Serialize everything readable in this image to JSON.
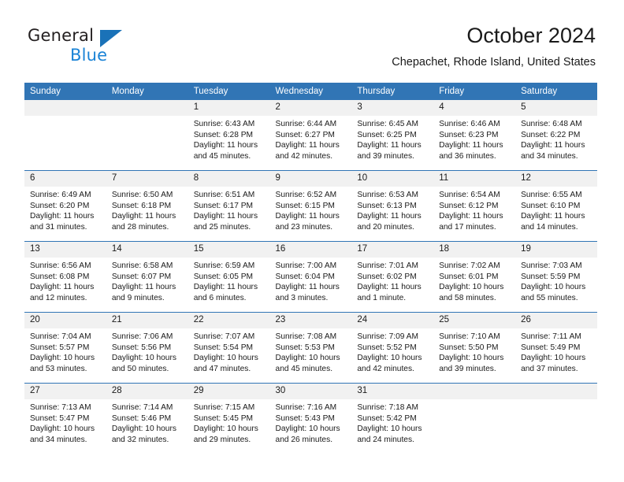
{
  "brand": {
    "name_part1": "General",
    "name_part2": "Blue",
    "logo_icon": "blue-triangle-icon"
  },
  "header": {
    "title": "October 2024",
    "location": "Chepachet, Rhode Island, United States"
  },
  "colors": {
    "header_blue": "#3175b5",
    "daynum_band": "#f1f1f1",
    "brand_blue": "#1a83d6",
    "logo_blue": "#1a72b8",
    "text": "#1a1a1a"
  },
  "calendar": {
    "weekday_headers": [
      "Sunday",
      "Monday",
      "Tuesday",
      "Wednesday",
      "Thursday",
      "Friday",
      "Saturday"
    ],
    "labels": {
      "sunrise": "Sunrise:",
      "sunset": "Sunset:",
      "daylight": "Daylight:"
    },
    "weeks": [
      [
        {
          "day": "",
          "empty": true
        },
        {
          "day": "",
          "empty": true
        },
        {
          "day": "1",
          "sunrise": "Sunrise: 6:43 AM",
          "sunset": "Sunset: 6:28 PM",
          "daylight_line1": "Daylight: 11 hours",
          "daylight_line2": "and 45 minutes."
        },
        {
          "day": "2",
          "sunrise": "Sunrise: 6:44 AM",
          "sunset": "Sunset: 6:27 PM",
          "daylight_line1": "Daylight: 11 hours",
          "daylight_line2": "and 42 minutes."
        },
        {
          "day": "3",
          "sunrise": "Sunrise: 6:45 AM",
          "sunset": "Sunset: 6:25 PM",
          "daylight_line1": "Daylight: 11 hours",
          "daylight_line2": "and 39 minutes."
        },
        {
          "day": "4",
          "sunrise": "Sunrise: 6:46 AM",
          "sunset": "Sunset: 6:23 PM",
          "daylight_line1": "Daylight: 11 hours",
          "daylight_line2": "and 36 minutes."
        },
        {
          "day": "5",
          "sunrise": "Sunrise: 6:48 AM",
          "sunset": "Sunset: 6:22 PM",
          "daylight_line1": "Daylight: 11 hours",
          "daylight_line2": "and 34 minutes."
        }
      ],
      [
        {
          "day": "6",
          "sunrise": "Sunrise: 6:49 AM",
          "sunset": "Sunset: 6:20 PM",
          "daylight_line1": "Daylight: 11 hours",
          "daylight_line2": "and 31 minutes."
        },
        {
          "day": "7",
          "sunrise": "Sunrise: 6:50 AM",
          "sunset": "Sunset: 6:18 PM",
          "daylight_line1": "Daylight: 11 hours",
          "daylight_line2": "and 28 minutes."
        },
        {
          "day": "8",
          "sunrise": "Sunrise: 6:51 AM",
          "sunset": "Sunset: 6:17 PM",
          "daylight_line1": "Daylight: 11 hours",
          "daylight_line2": "and 25 minutes."
        },
        {
          "day": "9",
          "sunrise": "Sunrise: 6:52 AM",
          "sunset": "Sunset: 6:15 PM",
          "daylight_line1": "Daylight: 11 hours",
          "daylight_line2": "and 23 minutes."
        },
        {
          "day": "10",
          "sunrise": "Sunrise: 6:53 AM",
          "sunset": "Sunset: 6:13 PM",
          "daylight_line1": "Daylight: 11 hours",
          "daylight_line2": "and 20 minutes."
        },
        {
          "day": "11",
          "sunrise": "Sunrise: 6:54 AM",
          "sunset": "Sunset: 6:12 PM",
          "daylight_line1": "Daylight: 11 hours",
          "daylight_line2": "and 17 minutes."
        },
        {
          "day": "12",
          "sunrise": "Sunrise: 6:55 AM",
          "sunset": "Sunset: 6:10 PM",
          "daylight_line1": "Daylight: 11 hours",
          "daylight_line2": "and 14 minutes."
        }
      ],
      [
        {
          "day": "13",
          "sunrise": "Sunrise: 6:56 AM",
          "sunset": "Sunset: 6:08 PM",
          "daylight_line1": "Daylight: 11 hours",
          "daylight_line2": "and 12 minutes."
        },
        {
          "day": "14",
          "sunrise": "Sunrise: 6:58 AM",
          "sunset": "Sunset: 6:07 PM",
          "daylight_line1": "Daylight: 11 hours",
          "daylight_line2": "and 9 minutes."
        },
        {
          "day": "15",
          "sunrise": "Sunrise: 6:59 AM",
          "sunset": "Sunset: 6:05 PM",
          "daylight_line1": "Daylight: 11 hours",
          "daylight_line2": "and 6 minutes."
        },
        {
          "day": "16",
          "sunrise": "Sunrise: 7:00 AM",
          "sunset": "Sunset: 6:04 PM",
          "daylight_line1": "Daylight: 11 hours",
          "daylight_line2": "and 3 minutes."
        },
        {
          "day": "17",
          "sunrise": "Sunrise: 7:01 AM",
          "sunset": "Sunset: 6:02 PM",
          "daylight_line1": "Daylight: 11 hours",
          "daylight_line2": "and 1 minute."
        },
        {
          "day": "18",
          "sunrise": "Sunrise: 7:02 AM",
          "sunset": "Sunset: 6:01 PM",
          "daylight_line1": "Daylight: 10 hours",
          "daylight_line2": "and 58 minutes."
        },
        {
          "day": "19",
          "sunrise": "Sunrise: 7:03 AM",
          "sunset": "Sunset: 5:59 PM",
          "daylight_line1": "Daylight: 10 hours",
          "daylight_line2": "and 55 minutes."
        }
      ],
      [
        {
          "day": "20",
          "sunrise": "Sunrise: 7:04 AM",
          "sunset": "Sunset: 5:57 PM",
          "daylight_line1": "Daylight: 10 hours",
          "daylight_line2": "and 53 minutes."
        },
        {
          "day": "21",
          "sunrise": "Sunrise: 7:06 AM",
          "sunset": "Sunset: 5:56 PM",
          "daylight_line1": "Daylight: 10 hours",
          "daylight_line2": "and 50 minutes."
        },
        {
          "day": "22",
          "sunrise": "Sunrise: 7:07 AM",
          "sunset": "Sunset: 5:54 PM",
          "daylight_line1": "Daylight: 10 hours",
          "daylight_line2": "and 47 minutes."
        },
        {
          "day": "23",
          "sunrise": "Sunrise: 7:08 AM",
          "sunset": "Sunset: 5:53 PM",
          "daylight_line1": "Daylight: 10 hours",
          "daylight_line2": "and 45 minutes."
        },
        {
          "day": "24",
          "sunrise": "Sunrise: 7:09 AM",
          "sunset": "Sunset: 5:52 PM",
          "daylight_line1": "Daylight: 10 hours",
          "daylight_line2": "and 42 minutes."
        },
        {
          "day": "25",
          "sunrise": "Sunrise: 7:10 AM",
          "sunset": "Sunset: 5:50 PM",
          "daylight_line1": "Daylight: 10 hours",
          "daylight_line2": "and 39 minutes."
        },
        {
          "day": "26",
          "sunrise": "Sunrise: 7:11 AM",
          "sunset": "Sunset: 5:49 PM",
          "daylight_line1": "Daylight: 10 hours",
          "daylight_line2": "and 37 minutes."
        }
      ],
      [
        {
          "day": "27",
          "sunrise": "Sunrise: 7:13 AM",
          "sunset": "Sunset: 5:47 PM",
          "daylight_line1": "Daylight: 10 hours",
          "daylight_line2": "and 34 minutes."
        },
        {
          "day": "28",
          "sunrise": "Sunrise: 7:14 AM",
          "sunset": "Sunset: 5:46 PM",
          "daylight_line1": "Daylight: 10 hours",
          "daylight_line2": "and 32 minutes."
        },
        {
          "day": "29",
          "sunrise": "Sunrise: 7:15 AM",
          "sunset": "Sunset: 5:45 PM",
          "daylight_line1": "Daylight: 10 hours",
          "daylight_line2": "and 29 minutes."
        },
        {
          "day": "30",
          "sunrise": "Sunrise: 7:16 AM",
          "sunset": "Sunset: 5:43 PM",
          "daylight_line1": "Daylight: 10 hours",
          "daylight_line2": "and 26 minutes."
        },
        {
          "day": "31",
          "sunrise": "Sunrise: 7:18 AM",
          "sunset": "Sunset: 5:42 PM",
          "daylight_line1": "Daylight: 10 hours",
          "daylight_line2": "and 24 minutes."
        },
        {
          "day": "",
          "empty": true
        },
        {
          "day": "",
          "empty": true
        }
      ]
    ]
  }
}
